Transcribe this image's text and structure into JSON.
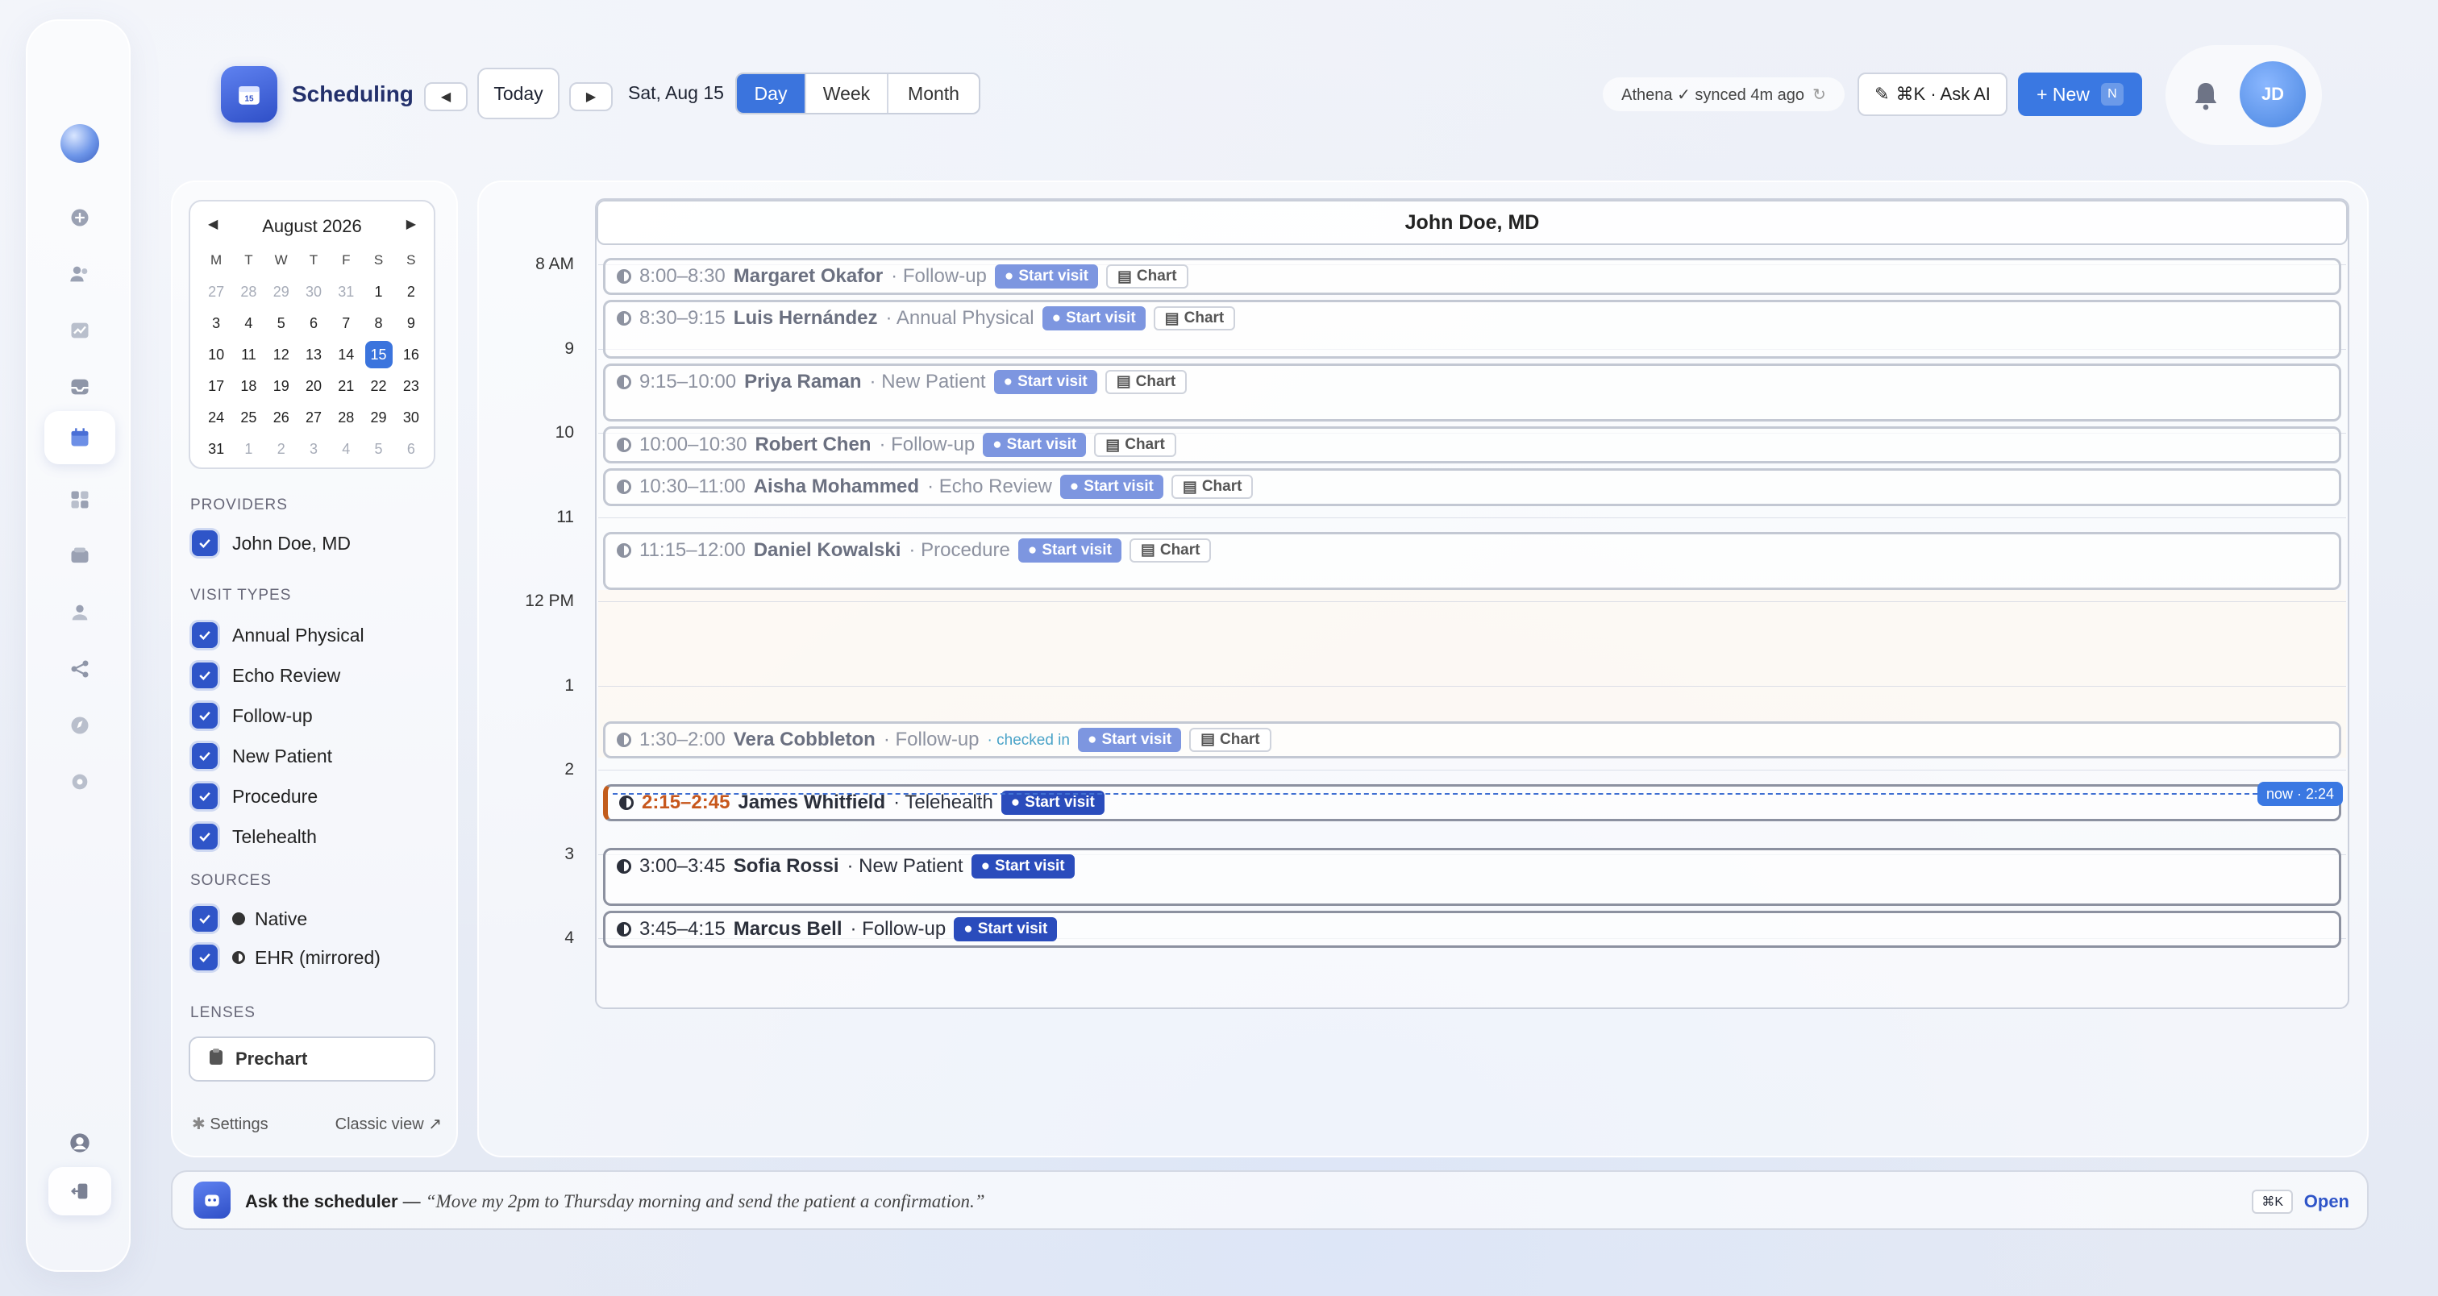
{
  "app": {
    "title": "Scheduling",
    "date_label": "Sat, Aug 15",
    "today_label": "Today"
  },
  "view_tabs": [
    {
      "label": "Day",
      "active": true
    },
    {
      "label": "Week",
      "active": false
    },
    {
      "label": "Month",
      "active": false
    }
  ],
  "sync": {
    "text": "Athena ✓ synced 4m ago"
  },
  "ask_ai": {
    "label": "⌘K · Ask AI"
  },
  "new_button": {
    "label": "+ New",
    "shortcut": "N"
  },
  "user": {
    "initials": "JD"
  },
  "mini_cal": {
    "month": "August 2026",
    "weekdays": [
      "M",
      "T",
      "W",
      "T",
      "F",
      "S",
      "S"
    ],
    "days": [
      {
        "d": "27",
        "o": true
      },
      {
        "d": "28",
        "o": true
      },
      {
        "d": "29",
        "o": true
      },
      {
        "d": "30",
        "o": true
      },
      {
        "d": "31",
        "o": true
      },
      {
        "d": "1"
      },
      {
        "d": "2"
      },
      {
        "d": "3"
      },
      {
        "d": "4"
      },
      {
        "d": "5"
      },
      {
        "d": "6"
      },
      {
        "d": "7"
      },
      {
        "d": "8"
      },
      {
        "d": "9"
      },
      {
        "d": "10"
      },
      {
        "d": "11"
      },
      {
        "d": "12"
      },
      {
        "d": "13"
      },
      {
        "d": "14"
      },
      {
        "d": "15",
        "s": true
      },
      {
        "d": "16"
      },
      {
        "d": "17"
      },
      {
        "d": "18"
      },
      {
        "d": "19"
      },
      {
        "d": "20"
      },
      {
        "d": "21"
      },
      {
        "d": "22"
      },
      {
        "d": "23"
      },
      {
        "d": "24"
      },
      {
        "d": "25"
      },
      {
        "d": "26"
      },
      {
        "d": "27"
      },
      {
        "d": "28"
      },
      {
        "d": "29"
      },
      {
        "d": "30"
      },
      {
        "d": "31"
      },
      {
        "d": "1",
        "o": true
      },
      {
        "d": "2",
        "o": true
      },
      {
        "d": "3",
        "o": true
      },
      {
        "d": "4",
        "o": true
      },
      {
        "d": "5",
        "o": true
      },
      {
        "d": "6",
        "o": true
      }
    ]
  },
  "sidebar": {
    "providers_title": "PROVIDERS",
    "providers": [
      "John Doe, MD"
    ],
    "visit_types_title": "VISIT TYPES",
    "visit_types": [
      "Annual Physical",
      "Echo Review",
      "Follow-up",
      "New Patient",
      "Procedure",
      "Telehealth"
    ],
    "sources_title": "SOURCES",
    "sources": [
      "Native",
      "EHR (mirrored)"
    ],
    "lenses_title": "LENSES",
    "lens": "Prechart",
    "settings": "Settings",
    "classic": "Classic view"
  },
  "calendar": {
    "provider": "John Doe, MD",
    "time_labels": [
      "8 AM",
      "9",
      "10",
      "11",
      "12 PM",
      "1",
      "2",
      "3",
      "4"
    ],
    "now_label": "now · 2:24",
    "start_visit": "Start visit",
    "chart": "Chart",
    "appointments": [
      {
        "time": "8:00–8:30",
        "patient": "Margaret Okafor",
        "type": "Follow-up",
        "source": "ehr"
      },
      {
        "time": "8:30–9:15",
        "patient": "Luis Hernández",
        "type": "Annual Physical",
        "source": "ehr"
      },
      {
        "time": "9:15–10:00",
        "patient": "Priya Raman",
        "type": "New Patient",
        "source": "ehr"
      },
      {
        "time": "10:00–10:30",
        "patient": "Robert Chen",
        "type": "Follow-up",
        "source": "ehr"
      },
      {
        "time": "10:30–11:00",
        "patient": "Aisha Mohammed",
        "type": "Echo Review",
        "source": "ehr"
      },
      {
        "time": "11:15–12:00",
        "patient": "Daniel Kowalski",
        "type": "Procedure",
        "source": "ehr"
      },
      {
        "time": "1:30–2:00",
        "patient": "Vera Cobbleton",
        "type": "Follow-up",
        "source": "ehr",
        "status": "checked in"
      },
      {
        "time": "2:15–2:45",
        "patient": "James Whitfield",
        "type": "Telehealth",
        "source": "native",
        "current": true
      },
      {
        "time": "3:00–3:45",
        "patient": "Sofia Rossi",
        "type": "New Patient",
        "source": "native"
      },
      {
        "time": "3:45–4:15",
        "patient": "Marcus Bell",
        "type": "Follow-up",
        "source": "native"
      }
    ]
  },
  "ask_bar": {
    "label": "Ask the scheduler",
    "dash": " — ",
    "example": "“Move my 2pm to Thursday morning and send the patient a confirmation.”",
    "shortcut": "⌘K",
    "open": "Open"
  },
  "colors": {
    "accent": "#3b74dd",
    "native_chip": "#2a4cbc",
    "ehr_chip": "#7d96e0",
    "current_time": "#c7571c"
  }
}
